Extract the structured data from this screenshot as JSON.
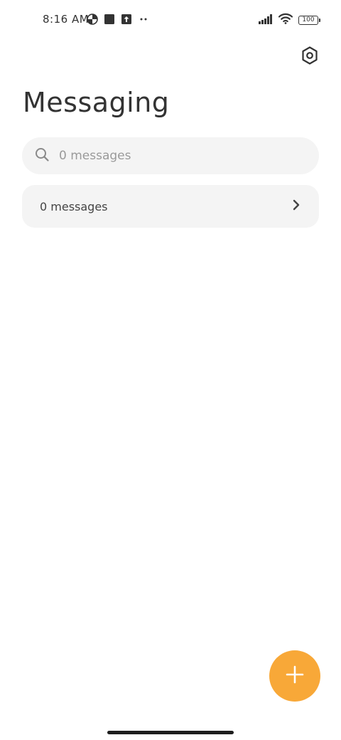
{
  "status_bar": {
    "time": "8:16 AM",
    "battery": "100",
    "icons": [
      "data-saver-icon",
      "square-notification-icon",
      "upload-icon",
      "more-dots-icon",
      "signal-icon",
      "wifi-icon",
      "battery-icon"
    ]
  },
  "header": {
    "title": "Messaging",
    "settings_icon": "settings-hex-icon"
  },
  "search": {
    "placeholder": "0 messages",
    "value": ""
  },
  "messages_row": {
    "label": "0 messages"
  },
  "fab": {
    "icon": "plus-icon",
    "color": "#f8a838"
  },
  "colors": {
    "accent": "#f8a838",
    "card_bg": "#f4f4f4",
    "text": "#333333"
  }
}
